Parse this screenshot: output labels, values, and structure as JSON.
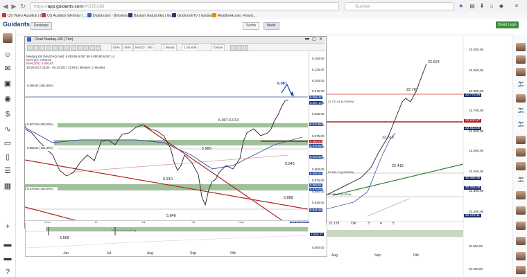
{
  "browser": {
    "url_prefix": "https://",
    "url_host": "app.guidants.com",
    "url_path": "/#!/150183",
    "search_placeholder": "Suchen",
    "bookmarks": [
      "US Video Ausblick | G...",
      "US Ausblick Webinar | ...",
      "Dashboard - BörseGo ...",
      "Bastian Galuschka | Gu...",
      "GodmodeTV | Guidants",
      "Realtimekurse, Finanz..."
    ]
  },
  "app": {
    "logo": "Guidants",
    "desktop_btn": "Desktops",
    "search_btn": "Suche",
    "market_btn": "Markt",
    "login_btn": "Direkt Login"
  },
  "chart_window": {
    "title": "Chart Nasdaq-100 (71m)",
    "toolbar": [
      "EMA",
      "SMA",
      "MACD",
      "RSI",
      "1 Monat",
      "1 Stunde",
      "Extras"
    ],
    "legend": [
      "Nasdaq 100 (NASDAQ, last): 6.053,55  6.057,98  6.050,80  6.057,14",
      "EMA(50): 5.985,90",
      "EMA(200): 5.946,63",
      "30.08.2017 15:30 - 05.10.2017 21:58  (1 Minuten, 1 Stunde)"
    ],
    "price_labels": [
      {
        "v": "6.150,00"
      },
      {
        "v": "6.125,00"
      },
      {
        "v": "6.100,00"
      },
      {
        "v": "6.075,00"
      },
      {
        "v": "6.050,00"
      },
      {
        "v": "6.025,00"
      },
      {
        "v": "6.000,00"
      },
      {
        "v": "5.975,00"
      },
      {
        "v": "5.950,00"
      },
      {
        "v": "5.925,00"
      },
      {
        "v": "5.900,00"
      },
      {
        "v": "5.875,00"
      },
      {
        "v": "5.850,00"
      },
      {
        "v": "5.825,00"
      }
    ],
    "boxes": [
      {
        "v": "6.066,47",
        "color": "#2b4f9c"
      },
      {
        "v": "6.057,14",
        "color": "#1b2f6b"
      },
      {
        "v": "6.012,95",
        "color": "#2b4f9c"
      },
      {
        "v": "5.985,90",
        "color": "#b22222"
      },
      {
        "v": "5.978,95",
        "color": "#2b4f9c"
      },
      {
        "v": "5.944,98",
        "color": "#2b4f9c"
      },
      {
        "v": "5.909,92",
        "color": "#2b4f9c"
      },
      {
        "v": "5.888,91",
        "color": "#2b4f9c"
      },
      {
        "v": "5.879,06",
        "color": "#2b4f9c"
      },
      {
        "v": "5.841,28",
        "color": "#2b4f9c"
      }
    ],
    "level_labels": [
      "6.086,91 (261,80%)",
      "6.007,50 (200,00%)",
      "5.958,81 (161,80%)",
      "5.879,56 (100,00%)"
    ],
    "annotations": [
      "6.087",
      "6.007-6.013",
      "5.980",
      "5.945",
      "5.910",
      "5.888",
      "5.840"
    ],
    "xlabels": [
      "Sep",
      "11",
      "18",
      "25",
      "Okt"
    ],
    "date_box": "10.10.2017"
  },
  "lower_window": {
    "annotations": [
      "5.568",
      "15:5  5.64 (100,00%)"
    ],
    "box": "5.568,47",
    "price_label": "5.500,00",
    "xlabels": [
      "Jun",
      "Jul",
      "Aug",
      "Sep",
      "Okt"
    ]
  },
  "right_chart": {
    "price_labels": [
      {
        "v": "23.000,00"
      },
      {
        "v": "22.900,00"
      },
      {
        "v": "22.800,00"
      },
      {
        "v": "22.700,00"
      },
      {
        "v": "22.600,00"
      },
      {
        "v": "22.500,00"
      },
      {
        "v": "22.400,00"
      },
      {
        "v": "22.300,00"
      },
      {
        "v": "22.200,00"
      }
    ],
    "boxes": [
      {
        "v": "22.775,39",
        "color": "#1b2f6b"
      },
      {
        "v": "22.640,17",
        "color": "#b22222"
      },
      {
        "v": "22.613,00",
        "color": "#1b2f6b"
      },
      {
        "v": "22.369,35",
        "color": "#1b2f6b"
      },
      {
        "v": "22.321,00",
        "color": "#1b2f6b"
      },
      {
        "v": "22.178,11",
        "color": "#1b2f6b"
      }
    ],
    "annotations": [
      "22.924",
      "22.787",
      "22.613",
      "22.418"
    ],
    "level_labels": [
      "22.737,61 (423,60%)",
      "22.394,74 (100,00%)",
      "22.288,97 (0,00%)"
    ],
    "xlabels": [
      "22.178",
      "Okt",
      "3",
      "4",
      "5"
    ],
    "lower_price_labels": [
      "20.600,00",
      "20.200,00"
    ],
    "lower_xlabels": [
      "Aug",
      "Sep",
      "Okt"
    ]
  },
  "right_sidebar_labels": [
    "dpa AFX",
    "dpa AFX",
    "dpa AFX",
    "dpa AFX"
  ]
}
